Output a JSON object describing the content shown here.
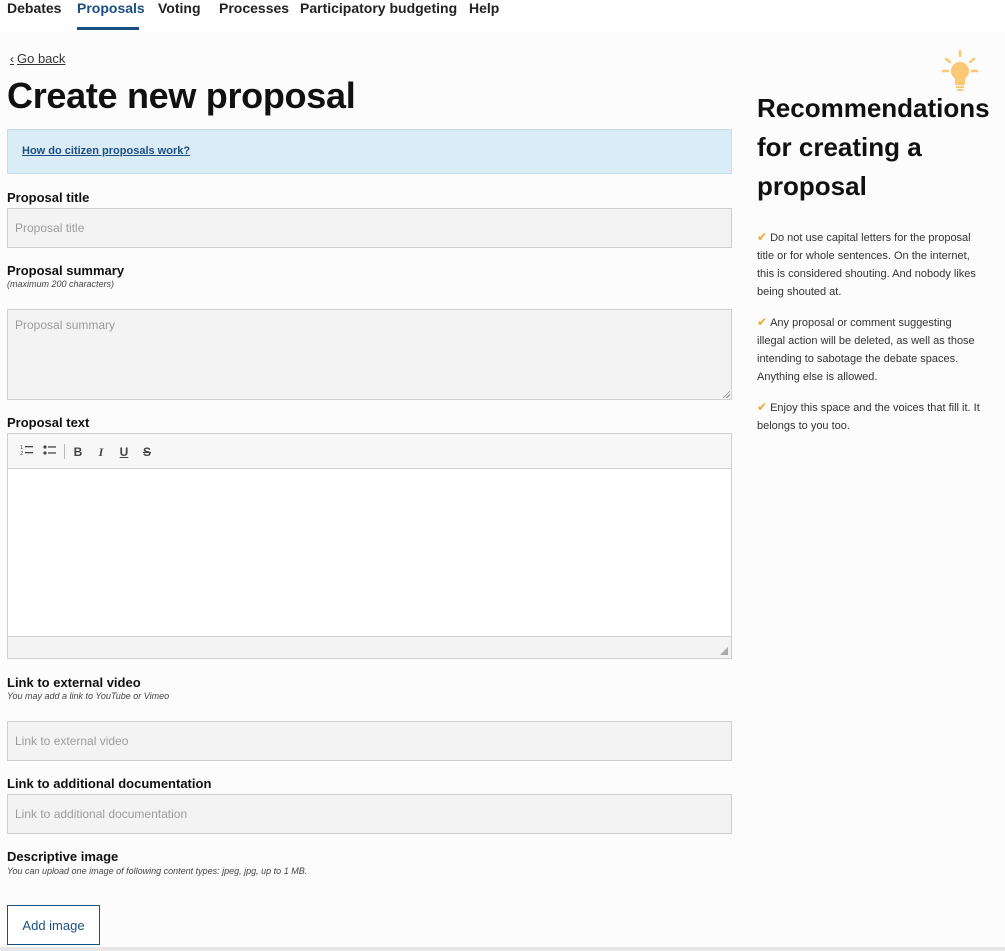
{
  "nav": {
    "items": [
      "Debates",
      "Proposals",
      "Voting",
      "Processes",
      "Participatory budgeting",
      "Help"
    ],
    "active": "Proposals"
  },
  "go_back": "Go back",
  "page_title": "Create new proposal",
  "callout_link": "How do citizen proposals work?",
  "form": {
    "title_label": "Proposal title",
    "title_placeholder": "Proposal title",
    "summary_label": "Proposal summary",
    "summary_hint": "(maximum 200 characters)",
    "summary_placeholder": "Proposal summary",
    "text_label": "Proposal text",
    "video_label": "Link to external video",
    "video_hint": "You may add a link to YouTube or Vimeo",
    "video_placeholder": "Link to external video",
    "doc_label": "Link to additional documentation",
    "doc_placeholder": "Link to additional documentation",
    "image_label": "Descriptive image",
    "image_hint": "You can upload one image of following content types: jpeg, jpg, up to 1 MB.",
    "add_image": "Add image"
  },
  "editor_toolbar": {
    "numbered_list": "numbered-list-icon",
    "bulleted_list": "bulleted-list-icon",
    "bold": "B",
    "italic": "I",
    "underline": "U",
    "strike": "S"
  },
  "sidebar": {
    "title": "Recommendations for creating a proposal",
    "icon": "lightbulb-icon",
    "recommendations": [
      "Do not use capital letters for the proposal title or for whole sentences. On the internet, this is considered shouting. And nobody likes being shouted at.",
      "Any proposal or comment suggesting illegal action will be deleted, as well as those intending to sabotage the debate spaces. Anything else is allowed.",
      "Enjoy this space and the voices that fill it. It belongs to you too."
    ]
  },
  "colors": {
    "accent": "#1b4f83",
    "callout_bg": "#daecf5",
    "check": "#f5a623",
    "bulb": "#fbc876"
  }
}
